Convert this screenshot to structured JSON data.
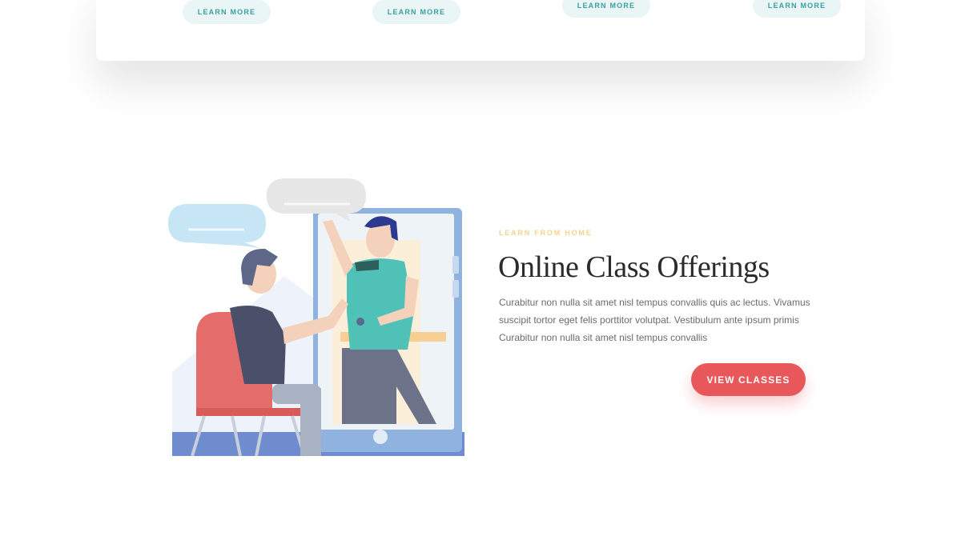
{
  "top_card": {
    "learn_more_buttons": [
      "LEARN MORE",
      "LEARN MORE",
      "LEARN MORE",
      "LEARN MORE"
    ]
  },
  "feature": {
    "eyebrow": "LEARN FROM HOME",
    "title": "Online Class Offerings",
    "body": "Curabitur non nulla sit amet nisl tempus convallis quis ac lectus. Vivamus suscipit tortor eget felis porttitor volutpat. Vestibulum ante ipsum primis Curabitur non nulla sit amet nisl tempus convallis",
    "cta_label": "VIEW CLASSES"
  },
  "colors": {
    "accent_red": "#e8575a",
    "teal_text": "#3a9fa0",
    "pill_bg": "#eaf6f6",
    "eyebrow_gold": "#f0d58a",
    "heading": "#2b2b2b"
  },
  "icons": [
    "speech-bubble-icon",
    "tablet-device-icon",
    "chair-icon",
    "person-icon"
  ]
}
